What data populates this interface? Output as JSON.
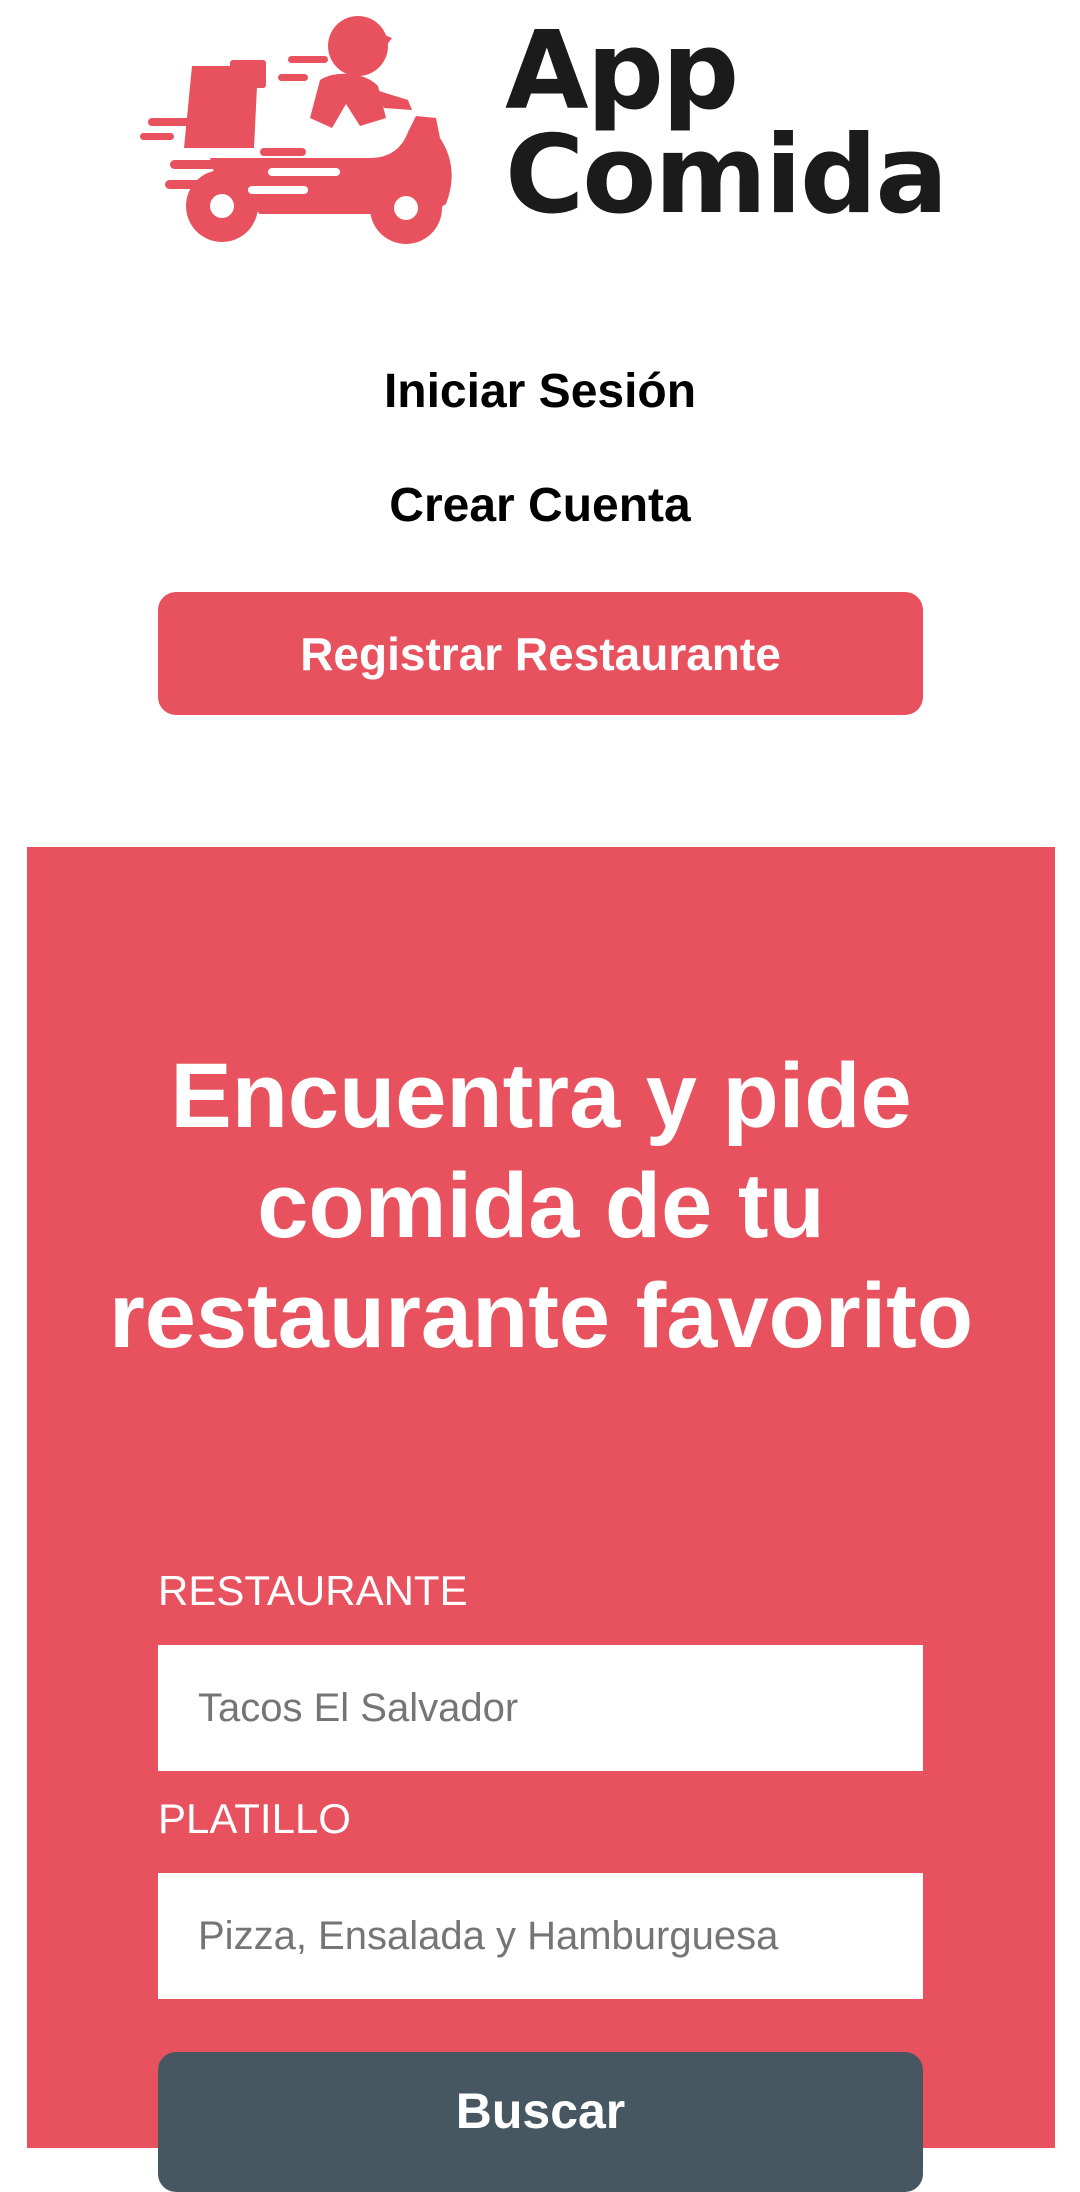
{
  "brand": {
    "name_line1": "App",
    "name_line2": "Comida",
    "logo_icon": "delivery-scooter-icon",
    "accent_color": "#e8515e"
  },
  "nav": {
    "login_label": "Iniciar Sesión",
    "signup_label": "Crear Cuenta",
    "register_restaurant_label": "Registrar Restaurante"
  },
  "hero": {
    "title": "Encuentra y pide comida de tu restaurante favorito",
    "background_color": "#e8515e"
  },
  "search_form": {
    "restaurant_label": "RESTAURANTE",
    "restaurant_placeholder": "Tacos El Salvador",
    "dish_label": "PLATILLO",
    "dish_placeholder": "Pizza, Ensalada y Hamburguesa",
    "submit_label": "Buscar",
    "submit_color": "#475762"
  }
}
